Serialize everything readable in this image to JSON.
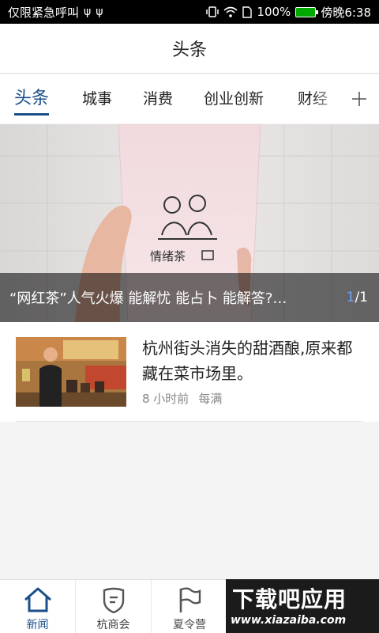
{
  "status_bar": {
    "carrier": "仅限紧急呼叫",
    "usb_icons": [
      "usb-icon",
      "usb-icon"
    ],
    "battery": "100%",
    "time": "傍晚6:38"
  },
  "header": {
    "title": "头条"
  },
  "tabs": {
    "items": [
      {
        "label": "头条",
        "active": true
      },
      {
        "label": "城事",
        "active": false
      },
      {
        "label": "消费",
        "active": false
      },
      {
        "label": "创业创新",
        "active": false
      },
      {
        "label": "财经",
        "active": false
      }
    ],
    "add_icon": "plus-icon"
  },
  "banner": {
    "caption": "“网红茶”人气火爆 能解忧 能占卜 能解答?…",
    "pager_current": "1",
    "pager_total": "/1",
    "cup_text": "情绪茶"
  },
  "news": [
    {
      "headline": "杭州街头消失的甜酒酿,原来都藏在菜市场里。",
      "time": "8 小时前",
      "source": "每满"
    }
  ],
  "bottom_nav": [
    {
      "label": "新闻",
      "icon": "home-icon",
      "active": true
    },
    {
      "label": "杭商会",
      "icon": "shield-icon",
      "active": false
    },
    {
      "label": "夏令营",
      "icon": "flag-icon",
      "active": false
    }
  ],
  "watermark": {
    "title": "下载吧应用",
    "url": "www.xiazaiba.com"
  },
  "colors": {
    "accent": "#1a4f8a",
    "status_bar": "#000000",
    "background": "#f4f4f4"
  }
}
